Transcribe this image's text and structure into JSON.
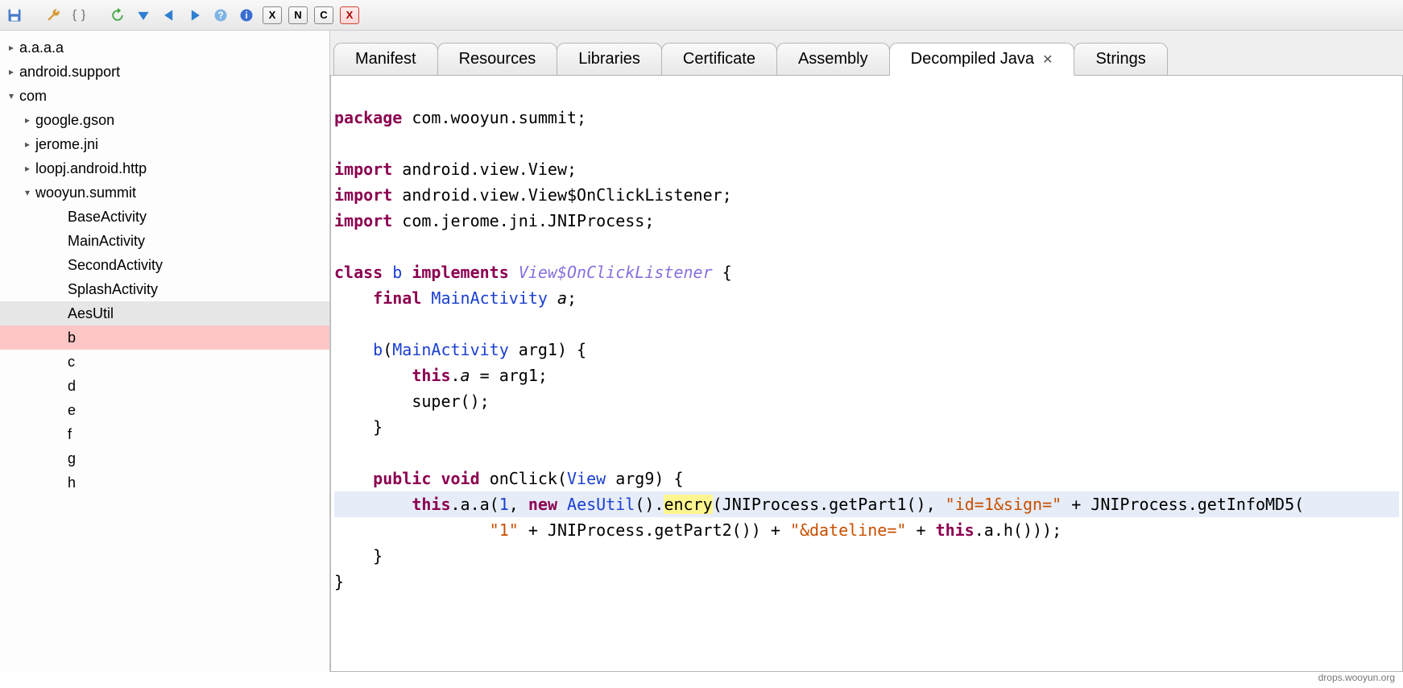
{
  "toolbar": {
    "letters": [
      "X",
      "N",
      "C"
    ],
    "close": "X"
  },
  "tree": {
    "items": [
      {
        "label": "a.a.a.a",
        "indent": 0,
        "arrow": "▸"
      },
      {
        "label": "android.support",
        "indent": 0,
        "arrow": "▸"
      },
      {
        "label": "com",
        "indent": 0,
        "arrow": "▾"
      },
      {
        "label": "google.gson",
        "indent": 1,
        "arrow": "▸"
      },
      {
        "label": "jerome.jni",
        "indent": 1,
        "arrow": "▸"
      },
      {
        "label": "loopj.android.http",
        "indent": 1,
        "arrow": "▸"
      },
      {
        "label": "wooyun.summit",
        "indent": 1,
        "arrow": "▾"
      },
      {
        "label": "BaseActivity",
        "indent": 2,
        "arrow": ""
      },
      {
        "label": "MainActivity",
        "indent": 2,
        "arrow": ""
      },
      {
        "label": "SecondActivity",
        "indent": 2,
        "arrow": ""
      },
      {
        "label": "SplashActivity",
        "indent": 2,
        "arrow": ""
      },
      {
        "label": "AesUtil",
        "indent": 2,
        "arrow": "",
        "selGray": true
      },
      {
        "label": "b",
        "indent": 2,
        "arrow": "",
        "selRed": true
      },
      {
        "label": "c",
        "indent": 2,
        "arrow": ""
      },
      {
        "label": "d",
        "indent": 2,
        "arrow": ""
      },
      {
        "label": "e",
        "indent": 2,
        "arrow": ""
      },
      {
        "label": "f",
        "indent": 2,
        "arrow": ""
      },
      {
        "label": "g",
        "indent": 2,
        "arrow": ""
      },
      {
        "label": "h",
        "indent": 2,
        "arrow": ""
      }
    ]
  },
  "tabs": {
    "items": [
      {
        "label": "Manifest"
      },
      {
        "label": "Resources"
      },
      {
        "label": "Libraries"
      },
      {
        "label": "Certificate"
      },
      {
        "label": "Assembly"
      },
      {
        "label": "Decompiled Java",
        "active": true,
        "close": "✕"
      },
      {
        "label": "Strings"
      }
    ]
  },
  "code": {
    "pkg_kw": "package",
    "pkg": " com.wooyun.summit;",
    "imp_kw": "import",
    "imp1": " android.view.View;",
    "imp2": " android.view.View$OnClickListener;",
    "imp3": " com.jerome.jni.JNIProcess;",
    "class_kw": "class ",
    "class_name": "b",
    "impl_kw": " implements ",
    "iface": "View$OnClickListener",
    "brace_open": " {",
    "final_kw": "final ",
    "mact": "MainActivity ",
    "field_a": "a",
    "semi": ";",
    "ctor_name": "b",
    "ctor_sig_open": "(",
    "arg_type": "MainActivity",
    "arg_name": " arg1) {",
    "this_kw": "this",
    "dot_a": ".",
    "eq_arg": " = arg1;",
    "super_call": "super();",
    "brace_close": "}",
    "pub_kw": "public ",
    "void_kw": "void ",
    "onclick": "onClick(",
    "view_t": "View",
    "arg9": " arg9) {",
    "line_hl_pre": "        this",
    "a_dot": ".a.a(",
    "one": "1",
    "comma_new": ", ",
    "new_kw": "new ",
    "aes": "AesUtil",
    "paren_dot": "().",
    "encry": "encry",
    "after_encry": "(JNIProcess.getPart1(), ",
    "str1": "\"id=1&sign=\"",
    "plus1": " + JNIProcess.getInfoMD5(",
    "line2_pre": "                ",
    "str2": "\"1\"",
    "plus2": " + JNIProcess.getPart2()) + ",
    "str3": "\"&dateline=\"",
    "plus3": " + ",
    "this2": "this",
    "tail": ".a.h()));"
  },
  "footer": "drops.wooyun.org"
}
